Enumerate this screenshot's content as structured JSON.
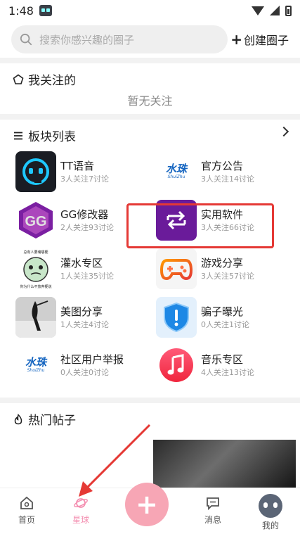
{
  "status_bar": {
    "time": "1:48"
  },
  "header": {
    "search_placeholder": "搜索你感兴趣的圈子",
    "create_plus": "+",
    "create_label": "创建圈子"
  },
  "follow_section": {
    "title": "我关注的",
    "empty_text": "暂无关注"
  },
  "boards_section": {
    "title": "板块列表",
    "items": [
      {
        "name": "TT语音",
        "stats": "3人关注7讨论",
        "icon": "tt-voice-icon"
      },
      {
        "name": "官方公告",
        "stats": "3人关注14讨论",
        "icon": "shuizhu-logo-icon",
        "logo_text": "水珠",
        "logo_sub": "ShuiZhu"
      },
      {
        "name": "GG修改器",
        "stats": "2人关注93讨论",
        "icon": "gg-modifier-icon"
      },
      {
        "name": "实用软件",
        "stats": "3人关注66讨论",
        "icon": "swap-arrows-icon"
      },
      {
        "name": "灌水专区",
        "stats": "1人关注35讨论",
        "icon": "meme-face-icon",
        "logo_top": "总有人要魂嚼梗",
        "logo_bottom": "你为什么不放弃梗说"
      },
      {
        "name": "游戏分享",
        "stats": "3人关注57讨论",
        "icon": "gamepad-icon"
      },
      {
        "name": "美图分享",
        "stats": "1人关注4讨论",
        "icon": "photo-thumbnail"
      },
      {
        "name": "骗子曝光",
        "stats": "0人关注1讨论",
        "icon": "shield-alert-icon"
      },
      {
        "name": "社区用户举报",
        "stats": "0人关注0讨论",
        "icon": "shuizhu-logo-icon",
        "logo_text": "水珠",
        "logo_sub": "ShuiZhu"
      },
      {
        "name": "音乐专区",
        "stats": "4人关注13讨论",
        "icon": "music-note-icon"
      }
    ]
  },
  "hot_section": {
    "title": "热门帖子"
  },
  "bottom_nav": {
    "home": "首页",
    "planet": "星球",
    "fab": "+",
    "messages": "消息",
    "mine": "我的"
  },
  "colors": {
    "accent_pink": "#f7a6b5",
    "active_tab": "#f48fb1",
    "annotation_red": "#e53935"
  }
}
